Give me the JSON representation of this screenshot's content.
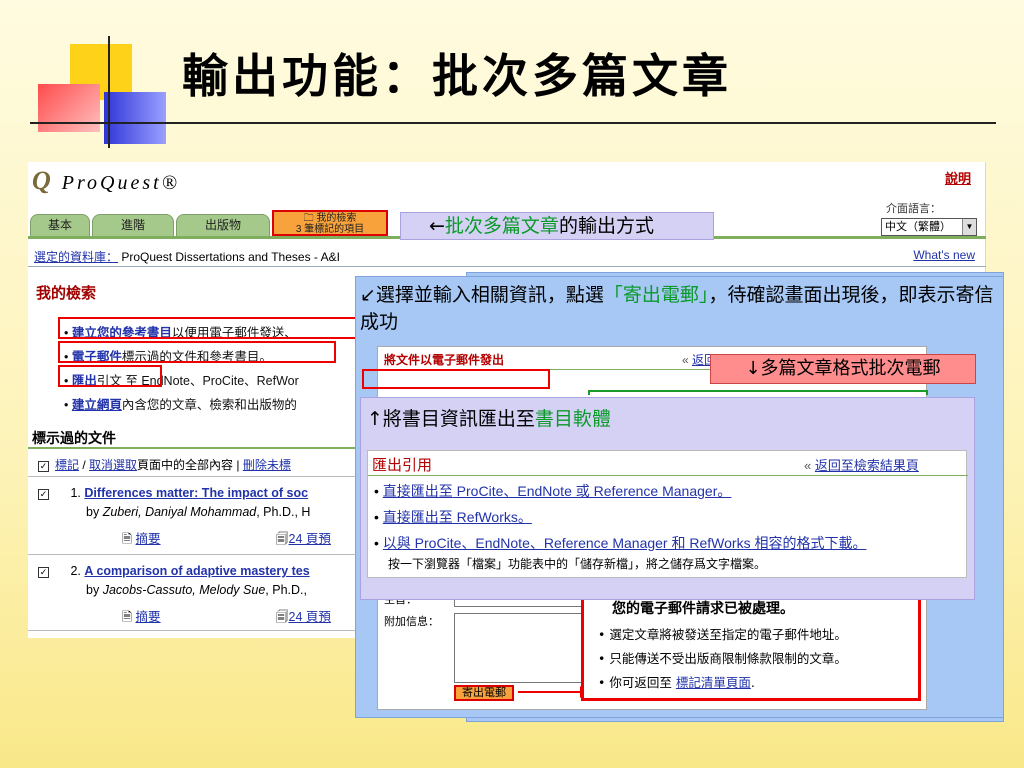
{
  "slide": {
    "title": "輸出功能：批次多篇文章"
  },
  "proquest": {
    "logo_q": "Q",
    "logo_text": "ProQuest®",
    "help": "說明",
    "language_label": "介面語言：",
    "language_value": "中文（繁體）",
    "tabs": [
      {
        "label": "基本"
      },
      {
        "label": "進階"
      },
      {
        "label": "出版物"
      }
    ],
    "my_search_tab": {
      "line1": "我的檢索",
      "line2": "3 筆標記的項目"
    },
    "database_label": "選定的資料庫：",
    "database_value": "ProQuest Dissertations and Theses - A&I",
    "whats_new": "What's new",
    "my_search_heading": "我的檢索",
    "options": [
      {
        "link": "建立您的參考書目",
        "text": "以便用電子郵件發送、"
      },
      {
        "link": "電子郵件",
        "text": "標示過的文件和參考書目。"
      },
      {
        "link": "匯出",
        "text": "引文 至 EndNote、ProCite、RefWor"
      },
      {
        "link": "建立網頁",
        "text": "內含您的文章、檢索和出版物的"
      }
    ],
    "marked_heading": "標示過的文件",
    "mark_row": {
      "mark": "標記",
      "sep": " / ",
      "unmark": "取消選取",
      "text": "頁面中的全部內容 | ",
      "delete": "刪除未標"
    },
    "results": [
      {
        "num": "1.",
        "title": "Differences matter: The impact of soc",
        "by_prefix": "by ",
        "author": "Zuberi, Daniyal Mohammad",
        "by_suffix": ", Ph.D., H",
        "abstract": "摘要",
        "pages": "24 頁預"
      },
      {
        "num": "2.",
        "title": "A comparison of adaptive mastery tes",
        "by_prefix": "by ",
        "author": "Jacobs-Cassuto, Melody Sue",
        "by_suffix": ", Ph.D.,",
        "abstract": "摘要",
        "pages": "24 頁預"
      }
    ]
  },
  "callouts": {
    "batch": "←批次多篇文章的輸出方式",
    "batch_green": "批次多篇文章",
    "batch_arrow": "←",
    "batch_rest": "的輸出方式",
    "email_instruction_a": "↙選擇並輸入相關資訊，點選",
    "email_instruction_green": "「寄出電郵」",
    "email_instruction_b": "，待確認畫面出現後，即表示寄信成功",
    "multi_email": "↓多篇文章格式批次電郵",
    "export_a": "↑將書目資訊匯出至",
    "export_green": "書目軟體"
  },
  "email_form": {
    "title": "將文件以電子郵件發出",
    "back_prefix": "« ",
    "back_link": "返回",
    "subject_label": "主旨：",
    "note_label": "附加信息：",
    "send_button": "寄出電郵",
    "confirm_title": "您的電子郵件請求已被處理。",
    "confirm_items": [
      {
        "text": "選定文章將被發送至指定的電子郵件地址。"
      },
      {
        "text": "只能傳送不受出版商限制條款限制的文章。"
      },
      {
        "text": "你可返回至 ",
        "link": "標記清單頁面",
        "tail": "."
      }
    ]
  },
  "export_box": {
    "title": "匯出引用",
    "back_prefix": "« ",
    "back_link": "返回至檢索結果頁",
    "items": [
      {
        "link": "直接匯出至",
        "text": " ProCite、EndNote 或 Reference Manager。"
      },
      {
        "link": "直接匯出至",
        "text": " RefWorks。"
      },
      {
        "link": "以與 ProCite、EndNote、Reference Manager 和 RefWorks 相容的格式下載。",
        "text": ""
      }
    ],
    "note": "按一下瀏覽器「檔案」功能表中的「儲存新檔」，將之儲存爲文字檔案。"
  },
  "colors": {
    "accent_green": "#0a9a2a",
    "link_blue": "#2233aa",
    "highlight_red": "#e00000",
    "tab_orange": "#f7a23a"
  }
}
